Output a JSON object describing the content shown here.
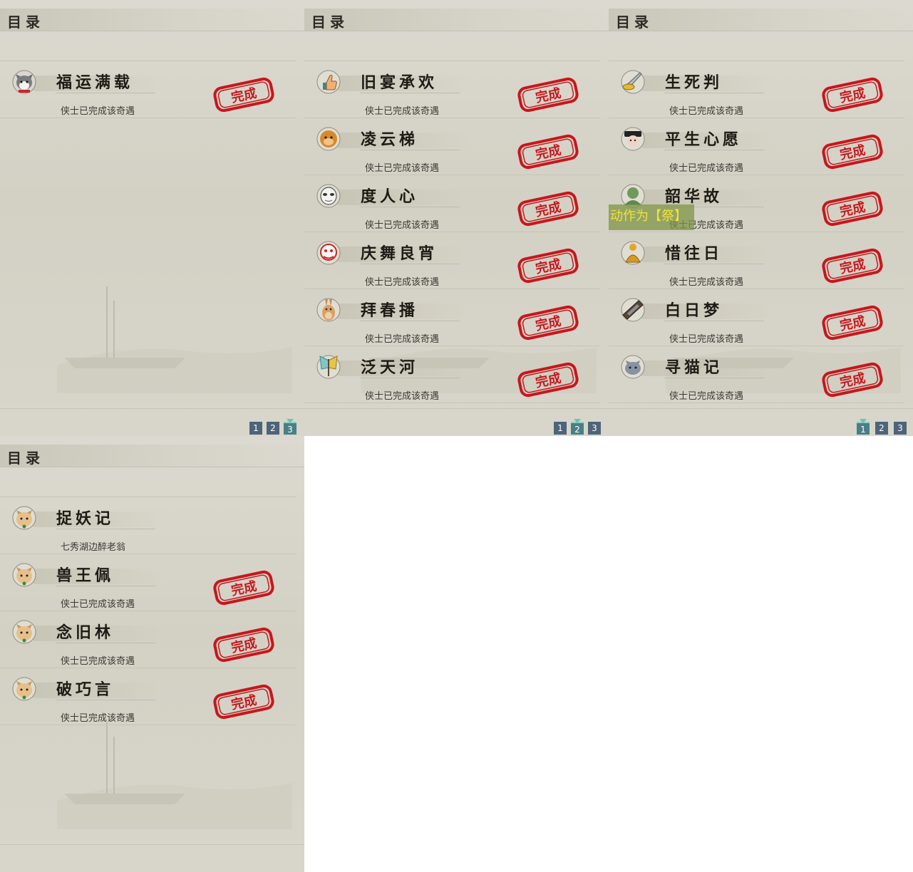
{
  "panels": [
    {
      "title": "目录",
      "entries": [
        {
          "name": "福运满载",
          "desc": "侠士已完成该奇遇",
          "icon": "husky-dog-icon",
          "stamp": true
        }
      ],
      "pager": [
        "1",
        "2",
        "3"
      ],
      "active_page": 3
    },
    {
      "title": "目录",
      "entries": [
        {
          "name": "旧宴承欢",
          "desc": "侠士已完成该奇遇",
          "icon": "thumbs-up-icon",
          "stamp": true
        },
        {
          "name": "凌云梯",
          "desc": "侠士已完成该奇遇",
          "icon": "monkey-face-icon",
          "stamp": true
        },
        {
          "name": "度人心",
          "desc": "侠士已完成该奇遇",
          "icon": "mask-icon",
          "stamp": true
        },
        {
          "name": "庆舞良宵",
          "desc": "侠士已完成该奇遇",
          "icon": "lion-dance-icon",
          "stamp": true
        },
        {
          "name": "拜春播",
          "desc": "侠士已完成该奇遇",
          "icon": "kangaroo-icon",
          "stamp": true
        },
        {
          "name": "泛天河",
          "desc": "侠士已完成该奇遇",
          "icon": "butterfly-icon",
          "stamp": true
        }
      ],
      "pager": [
        "1",
        "2",
        "3"
      ],
      "active_page": 2
    },
    {
      "title": "目录",
      "entries": [
        {
          "name": "生死判",
          "desc": "侠士已完成该奇遇",
          "icon": "sword-gold-icon",
          "stamp": true
        },
        {
          "name": "平生心愿",
          "desc": "侠士已完成该奇遇",
          "icon": "official-hat-icon",
          "stamp": true
        },
        {
          "name": "韶华故",
          "desc": "侠士已完成该奇遇",
          "icon": "green-bust-icon",
          "stamp": true
        },
        {
          "name": "惜往日",
          "desc": "侠士已完成该奇遇",
          "icon": "golden-buddha-icon",
          "stamp": true
        },
        {
          "name": "白日梦",
          "desc": "侠士已完成该奇遇",
          "icon": "dream-bed-icon",
          "stamp": true
        },
        {
          "name": "寻猫记",
          "desc": "侠士已完成该奇遇",
          "icon": "grey-cat-icon",
          "stamp": true
        }
      ],
      "pager": [
        "1",
        "2",
        "3"
      ],
      "active_page": 1,
      "tooltip": "动作为【祭】"
    },
    {
      "title": "目录",
      "entries": [
        {
          "name": "捉妖记",
          "desc": "七秀湖边醉老翁",
          "icon": "cat-icon",
          "stamp": false
        },
        {
          "name": "兽王佩",
          "desc": "侠士已完成该奇遇",
          "icon": "cat-icon",
          "stamp": true
        },
        {
          "name": "念旧林",
          "desc": "侠士已完成该奇遇",
          "icon": "cat-icon",
          "stamp": true
        },
        {
          "name": "破巧言",
          "desc": "侠士已完成该奇遇",
          "icon": "cat-icon",
          "stamp": true
        }
      ],
      "pager": [],
      "active_page": 0
    }
  ],
  "stamp_text": "完成",
  "colors": {
    "stamp_red": "#c8161d",
    "page_btn": "#4d6479",
    "page_btn_active": "#4a7f86",
    "tooltip_text": "#f2e23a"
  }
}
